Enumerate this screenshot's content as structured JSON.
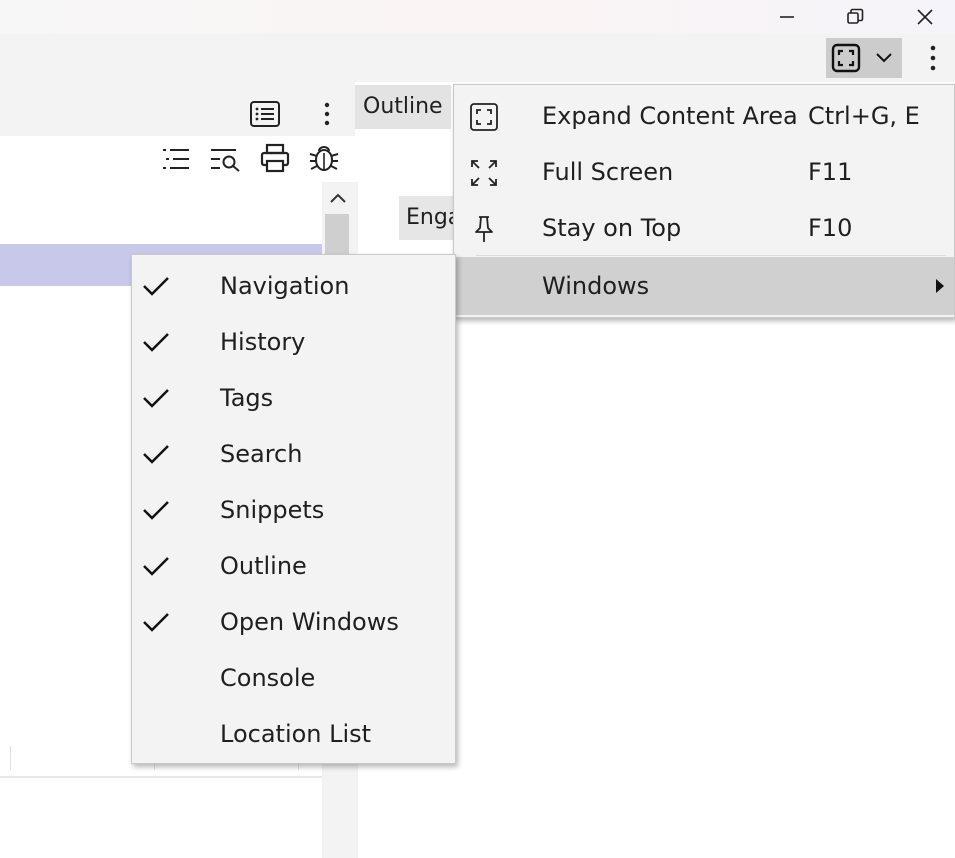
{
  "main_menu": {
    "items": [
      {
        "label": "Expand Content Area",
        "shortcut": "Ctrl+G, E",
        "icon": "expand-content-icon"
      },
      {
        "label": "Full Screen",
        "shortcut": "F11",
        "icon": "full-screen-icon"
      },
      {
        "label": "Stay on Top",
        "shortcut": "F10",
        "icon": "pin-icon"
      },
      {
        "label": "Windows",
        "shortcut": "",
        "icon": "submenu-arrow-icon"
      }
    ]
  },
  "windows_submenu": {
    "items": [
      {
        "label": "Navigation",
        "checked": true
      },
      {
        "label": "History",
        "checked": true
      },
      {
        "label": "Tags",
        "checked": true
      },
      {
        "label": "Search",
        "checked": true
      },
      {
        "label": "Snippets",
        "checked": true
      },
      {
        "label": "Outline",
        "checked": true
      },
      {
        "label": "Open Windows",
        "checked": true
      },
      {
        "label": "Console",
        "checked": false
      },
      {
        "label": "Location List",
        "checked": false
      }
    ]
  },
  "panel": {
    "outline_tab": "Outline",
    "eng_tab": "Enga"
  },
  "colors": {
    "selection": "#c8c9ea",
    "menu_bg": "#f3f3f3",
    "highlight": "#d0d0d0"
  }
}
